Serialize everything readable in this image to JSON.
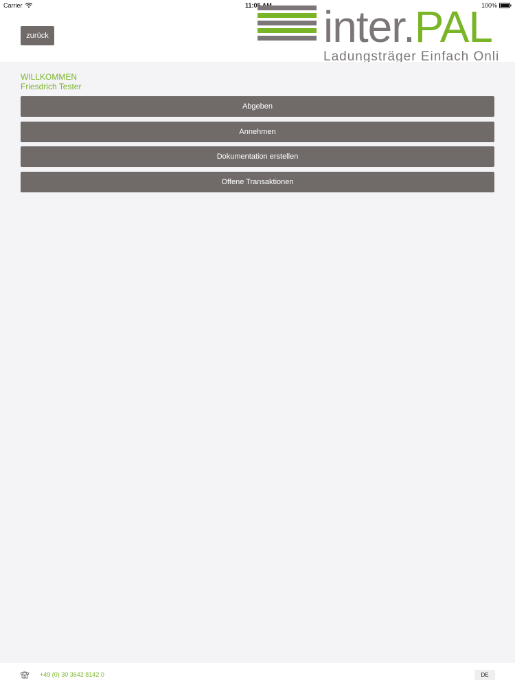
{
  "status_bar": {
    "carrier": "Carrier",
    "time": "11:05 AM",
    "battery": "100%"
  },
  "header": {
    "back_label": "zurück",
    "logo": {
      "word_inter": "inter.",
      "word_pal": "PAL",
      "slogan": "Ladungsträger Einfach Online",
      "colors": {
        "gray": "#7c7679",
        "green": "#7ab527"
      }
    }
  },
  "welcome": {
    "heading": "WILLKOMMEN",
    "user_name": "Friesdrich Tester"
  },
  "menu": {
    "items": [
      {
        "label": "Abgeben"
      },
      {
        "label": "Annehmen"
      },
      {
        "label": "Dokumentation erstellen"
      },
      {
        "label": "Offene Transaktionen"
      }
    ]
  },
  "footer": {
    "phone_icon": "telephone-icon",
    "phone": "+49 (0) 30 3642 8142 0",
    "language": "DE"
  },
  "colors": {
    "accent_green": "#7ab527",
    "button_gray": "#706b69",
    "background": "#f4f3f6"
  }
}
